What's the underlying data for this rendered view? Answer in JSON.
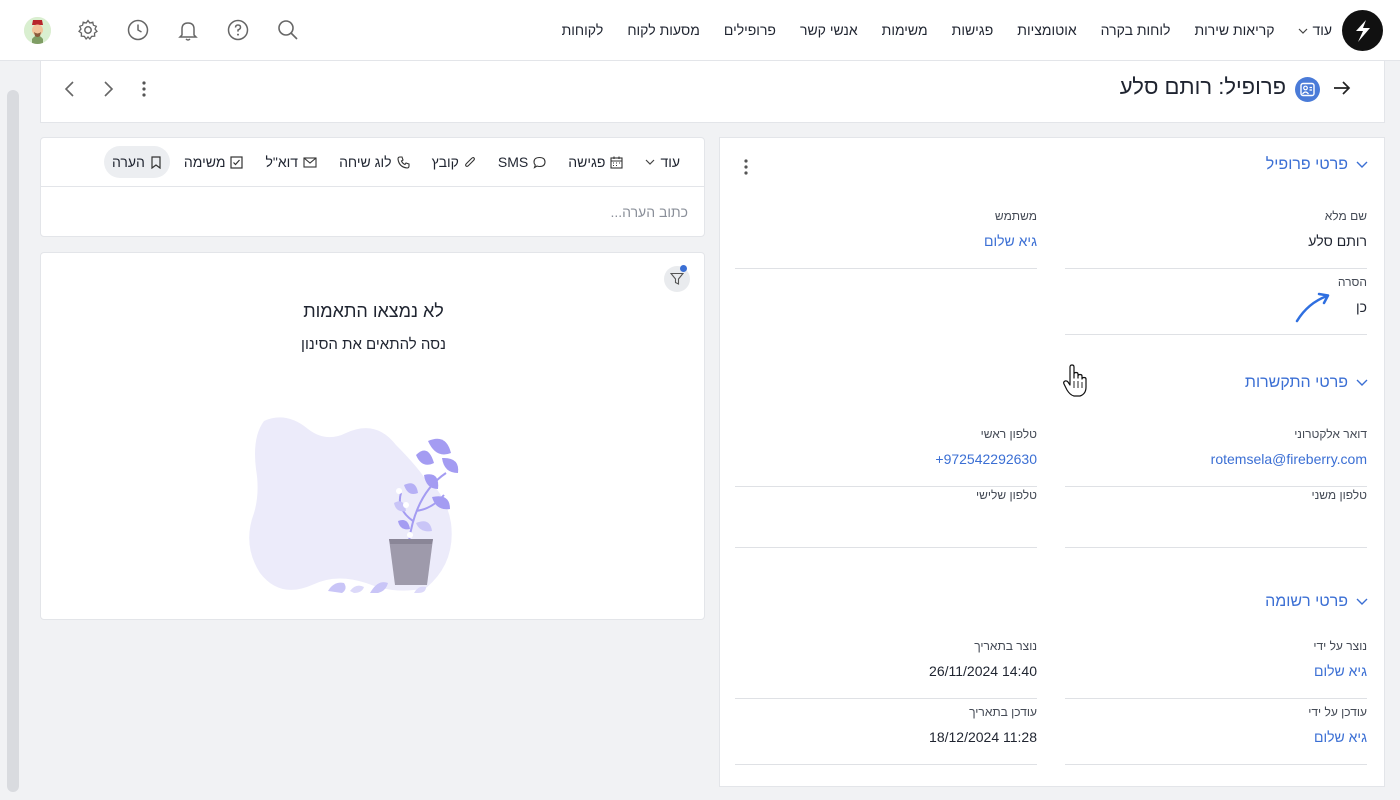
{
  "nav": {
    "items": [
      "לקוחות",
      "מסעות לקוח",
      "פרופילים",
      "אנשי קשר",
      "משימות",
      "פגישות",
      "אוטומציות",
      "לוחות בקרה",
      "קריאות שירות"
    ],
    "more_label": "עוד",
    "icons": [
      "search-icon",
      "help-icon",
      "bell-icon",
      "clock-icon",
      "gear-icon"
    ]
  },
  "header": {
    "title": "פרופיל: רותם סלע"
  },
  "profile_section": {
    "title": "פרטי פרופיל",
    "fields": [
      {
        "label": "שם מלא",
        "value": "רותם סלע",
        "link": false
      },
      {
        "label": "משתמש",
        "value": "גיא שלום",
        "link": true
      },
      {
        "label": "הסרה",
        "value": "כן",
        "link": false
      }
    ]
  },
  "contact_section": {
    "title": "פרטי התקשרות",
    "fields": [
      {
        "label": "דואר אלקטרוני",
        "value": "rotemsela@fireberry.com",
        "link": true
      },
      {
        "label": "טלפון ראשי",
        "value": "972542292630+",
        "link": true
      },
      {
        "label": "טלפון משני",
        "value": "",
        "link": false
      },
      {
        "label": "טלפון שלישי",
        "value": "",
        "link": false
      }
    ]
  },
  "record_section": {
    "title": "פרטי רשומה",
    "fields": [
      {
        "label": "נוצר על ידי",
        "value": "גיא שלום",
        "link": true
      },
      {
        "label": "נוצר בתאריך",
        "value": "14:40 26/11/2024",
        "link": false
      },
      {
        "label": "עודכן על ידי",
        "value": "גיא שלום",
        "link": true
      },
      {
        "label": "עודכן בתאריך",
        "value": "11:28 18/12/2024",
        "link": false
      }
    ]
  },
  "composer": {
    "tabs": [
      "הערה",
      "משימה",
      "דוא\"ל",
      "לוג שיחה",
      "קובץ",
      "SMS",
      "פגישה"
    ],
    "more_label": "עוד",
    "placeholder": "כתוב הערה..."
  },
  "activity": {
    "empty_title": "לא נמצאו התאמות",
    "empty_subtitle": "נסה להתאים את הסינון"
  },
  "colors": {
    "accent": "#3b6fd4",
    "illustration_purple": "#a49cf2",
    "illustration_blob": "#ecebfa",
    "pot": "#9e9aab"
  }
}
